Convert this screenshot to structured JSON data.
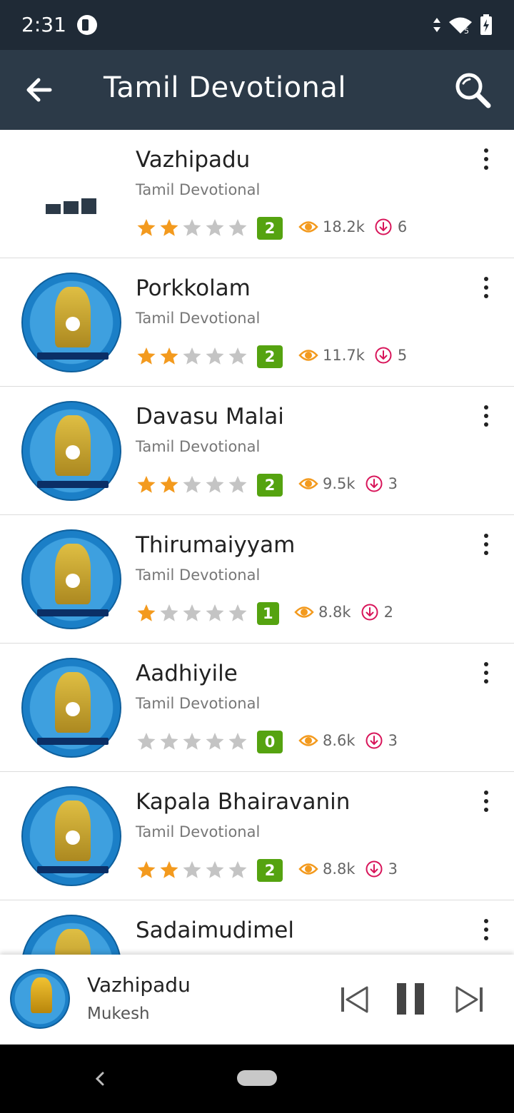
{
  "status_bar": {
    "time": "2:31",
    "network_label": "5"
  },
  "app_bar": {
    "title": "Tamil Devotional"
  },
  "colors": {
    "status_bar": "#1f2a36",
    "app_bar": "#2c3a48",
    "star_filled": "#f39a1e",
    "star_empty": "#c4c4c4",
    "badge": "#55a310",
    "views": "#f39a1e",
    "downloads": "#d8155a"
  },
  "songs": [
    {
      "title": "Vazhipadu",
      "subtitle": "Tamil Devotional",
      "rating": 2,
      "rating_label": "2",
      "views": "18.2k",
      "downloads": "6",
      "thumb": "loading-icon"
    },
    {
      "title": "Porkkolam",
      "subtitle": "Tamil Devotional",
      "rating": 2,
      "rating_label": "2",
      "views": "11.7k",
      "downloads": "5",
      "thumb": "album-art"
    },
    {
      "title": "Davasu Malai",
      "subtitle": "Tamil Devotional",
      "rating": 2,
      "rating_label": "2",
      "views": "9.5k",
      "downloads": "3",
      "thumb": "album-art"
    },
    {
      "title": "Thirumaiyyam",
      "subtitle": "Tamil Devotional",
      "rating": 1,
      "rating_label": "1",
      "views": "8.8k",
      "downloads": "2",
      "thumb": "album-art"
    },
    {
      "title": "Aadhiyile",
      "subtitle": "Tamil Devotional",
      "rating": 0,
      "rating_label": "0",
      "views": "8.6k",
      "downloads": "3",
      "thumb": "album-art"
    },
    {
      "title": "Kapala Bhairavanin",
      "subtitle": "Tamil Devotional",
      "rating": 2,
      "rating_label": "2",
      "views": "8.8k",
      "downloads": "3",
      "thumb": "album-art"
    },
    {
      "title": "Sadaimudimel",
      "subtitle": "",
      "rating": 0,
      "rating_label": "",
      "views": "",
      "downloads": "",
      "thumb": "album-art"
    }
  ],
  "mini_player": {
    "title": "Vazhipadu",
    "artist": "Mukesh",
    "state": "playing"
  }
}
